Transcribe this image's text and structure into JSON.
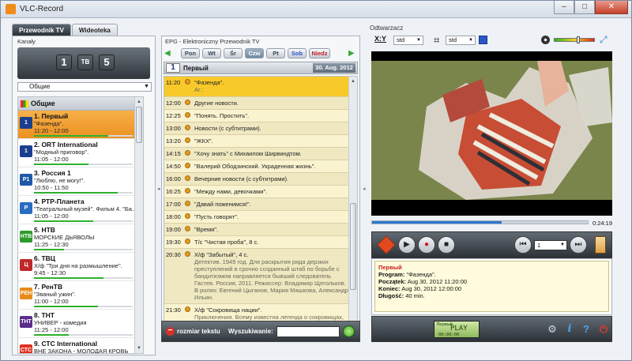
{
  "window": {
    "title": "VLC-Record",
    "btn_min": "–",
    "btn_max": "□",
    "btn_close": "✕"
  },
  "left": {
    "tabs": [
      {
        "label": "Przewodnik TV",
        "active": true
      },
      {
        "label": "Wideoteka",
        "active": false
      }
    ],
    "section_label": "Kanały",
    "channel_buttons": [
      {
        "label": "1",
        "color": "#d7281e"
      },
      {
        "label": "ТВ",
        "color": "#2a9d2a"
      },
      {
        "label": "5",
        "color": "#e0331f"
      }
    ],
    "group_select": "Общие",
    "group_header": "Общие",
    "channels": [
      {
        "name": "1. Первый",
        "program": "\"Фазенда\".",
        "time": "11:20 - 12:00",
        "progress": 0.75,
        "selected": true,
        "logo": "1",
        "logo_color": "#1b3f8f"
      },
      {
        "name": "2. ORT International",
        "program": "\"Модный приговор\".",
        "time": "11:05 - 12:00",
        "progress": 0.55,
        "selected": false,
        "logo": "1",
        "logo_color": "#1b3f8f"
      },
      {
        "name": "3. Россия 1",
        "program": "\"Люблю, не могу!\".",
        "time": "10:50 - 11:50",
        "progress": 0.85,
        "selected": false,
        "logo": "Р1",
        "logo_color": "#1f5aa8"
      },
      {
        "name": "4. РТР-Планета",
        "program": "\"Театральный музей\". Фильм 4. \"Ба...",
        "time": "11:05 - 12:00",
        "progress": 0.6,
        "selected": false,
        "logo": "Р",
        "logo_color": "#2a6cc0"
      },
      {
        "name": "5. НТВ",
        "program": "МОРСКИЕ ДЬЯВОЛЫ",
        "time": "11:25 - 12:30",
        "progress": 0.3,
        "selected": false,
        "logo": "НТВ",
        "logo_color": "#2c9b2c"
      },
      {
        "name": "6. ТВЦ",
        "program": "Х/ф \"Три дня на размышление\".",
        "time": "9:45 - 12:30",
        "progress": 0.7,
        "selected": false,
        "logo": "Ц",
        "logo_color": "#c0282a"
      },
      {
        "name": "7. РенТВ",
        "program": "\"Званый ужин\".",
        "time": "11:00 - 12:00",
        "progress": 0.65,
        "selected": false,
        "logo": "РЕН",
        "logo_color": "#e88a1a"
      },
      {
        "name": "8. ТНТ",
        "program": "УНИВЕР - комедия",
        "time": "11:25 - 12:00",
        "progress": 0.35,
        "selected": false,
        "logo": "ТНТ",
        "logo_color": "#5a2d8c"
      },
      {
        "name": "9. СТС International",
        "program": "ВНЕ ЗАКОНА - МОЛОДАЯ КРОВЬ",
        "time": "",
        "progress": 0.2,
        "selected": false,
        "logo": "СТС",
        "logo_color": "#e0301e"
      }
    ]
  },
  "epg": {
    "title": "EPG - Elektroniczny Przewodnik TV",
    "days": [
      {
        "label": "Pon",
        "state": ""
      },
      {
        "label": "Wt",
        "state": ""
      },
      {
        "label": "Śr",
        "state": ""
      },
      {
        "label": "Czw",
        "state": "on"
      },
      {
        "label": "Pt",
        "state": ""
      },
      {
        "label": "Sob",
        "state": "sat"
      },
      {
        "label": "Niedz",
        "state": "sun"
      }
    ],
    "channel_logo": "1",
    "channel_name": "Первый",
    "date": "30. Aug. 2012",
    "rows": [
      {
        "time": "11:20",
        "title": "\"Фазенда\".",
        "desc": "Ar.:",
        "now": true
      },
      {
        "time": "12:00",
        "title": "Другие новости.",
        "desc": ""
      },
      {
        "time": "12:25",
        "title": "\"Понять. Простить\".",
        "desc": ""
      },
      {
        "time": "13:00",
        "title": "Новости (с субтитрами).",
        "desc": ""
      },
      {
        "time": "13:20",
        "title": "\"ЖКХ\".",
        "desc": ""
      },
      {
        "time": "14:15",
        "title": "\"Хочу знать\" с Михаилом Ширвиндтом.",
        "desc": ""
      },
      {
        "time": "14:50",
        "title": "\"Валерий Ободзинский. Украденная жизнь\".",
        "desc": ""
      },
      {
        "time": "16:00",
        "title": "Вечерние новости (с субтитрами).",
        "desc": ""
      },
      {
        "time": "16:25",
        "title": "\"Между нами, девочками\".",
        "desc": ""
      },
      {
        "time": "17:00",
        "title": "\"Давай поженимся!\".",
        "desc": ""
      },
      {
        "time": "18:00",
        "title": "\"Пусть говорят\".",
        "desc": ""
      },
      {
        "time": "19:00",
        "title": "\"Время\".",
        "desc": ""
      },
      {
        "time": "19:30",
        "title": "Т/с \"Чистая проба\", 8 с.",
        "desc": ""
      },
      {
        "time": "20:30",
        "title": "Х/ф \"Забытый\", 4 с.",
        "desc": "Детектив. 1949 год. Для раскрытия ряда дерзких преступлений в срочно созданный штаб по борьбе с бандитизмом направляется бывший следователь Гастев. Россия, 2011. Режиссер: Владимир Щегольков. В ролях: Евгений Цыганов, Мария Машкова, Александр Ильин."
      },
      {
        "time": "21:30",
        "title": "Х/ф \"Сокровища нации\".",
        "desc": "Приключения. Всему известна легенда о сокровищах, спрятанных основателями США. В поисках"
      }
    ],
    "footer": {
      "text_size_label": "rozmiar tekstu",
      "search_label": "Wyszukiwanie:",
      "search_value": ""
    }
  },
  "player": {
    "title": "Odtwarzacz",
    "aspect_label": "X:Y",
    "aspect_value": "std",
    "crop_value": "std",
    "time": "0:24:19",
    "progress": 0.6,
    "volume": 0.55,
    "channel_value": "1",
    "info": {
      "channel": "Первый",
      "program_label": "Program:",
      "program": "\"Фазенда\".",
      "start_label": "Początek:",
      "start": "Aug 30, 2012 11:20:00",
      "end_label": "Koniec:",
      "end": "Aug 30, 2012 12:00:00",
      "length_label": "Długość:",
      "length": "40 min."
    },
    "lcd": {
      "line1": "Первый",
      "line2": "PLAY",
      "line3": "00:00:00"
    }
  }
}
